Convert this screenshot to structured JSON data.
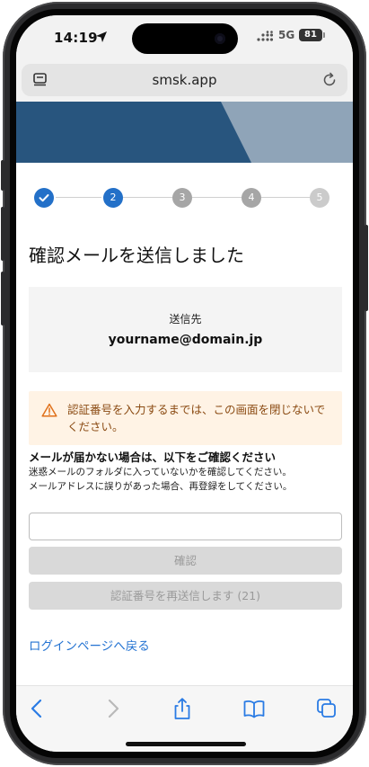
{
  "status_bar": {
    "time": "14:19",
    "network": "5G",
    "battery": "81"
  },
  "browser": {
    "url": "smsk.app"
  },
  "stepper": {
    "steps": [
      "",
      "2",
      "3",
      "4",
      "5"
    ],
    "current_step": 2
  },
  "page": {
    "title": "確認メールを送信しました",
    "recipient_label": "送信先",
    "recipient_email": "yourname@domain.jp",
    "alert_text": "認証番号を入力するまでは、この画面を閉じないでください。",
    "help_heading": "メールが届かない場合は、以下をご確認ください",
    "help_lines": [
      "迷惑メールのフォルダに入っていないかを確認してください。",
      "メールアドレスに誤りがあった場合、再登録をしてください。"
    ],
    "code_input": {
      "value": "",
      "placeholder": ""
    },
    "confirm_button": "確認",
    "resend_button": "認証番号を再送信します (21)",
    "back_link": "ログインページへ戻る"
  },
  "colors": {
    "accent": "#2370c8",
    "banner": "#28557e",
    "alert_bg": "#fff3e5",
    "alert_text": "#8a4a12",
    "link": "#2473d2"
  }
}
